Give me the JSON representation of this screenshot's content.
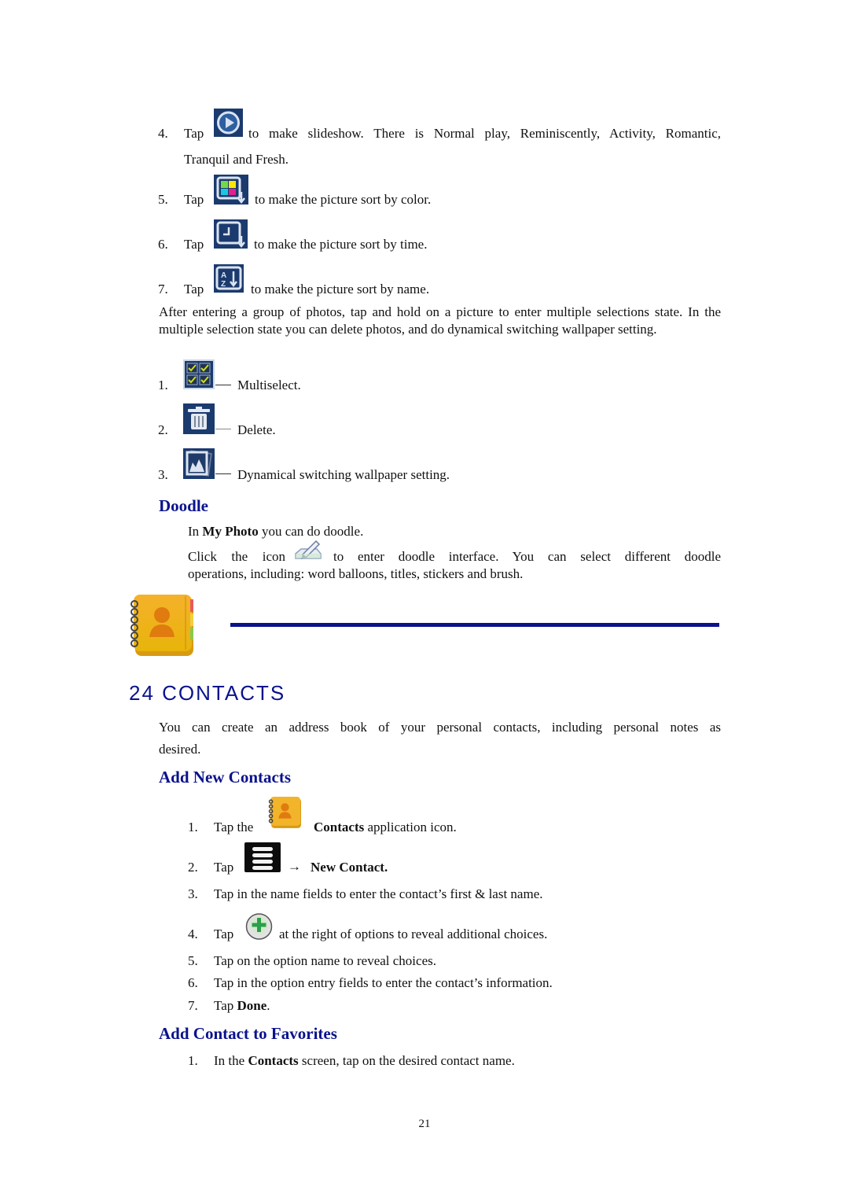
{
  "page_number": "21",
  "slideshow_steps": [
    {
      "num": "4.",
      "pre": "Tap",
      "icon": "play-slideshow-icon",
      "text": "to make slideshow. There is Normal play, Reminiscently, Activity, Romantic,",
      "text_cont": "Tranquil and Fresh."
    },
    {
      "num": "5.",
      "pre": "Tap",
      "icon": "sort-by-color-icon",
      "text": "to make the picture sort by color."
    },
    {
      "num": "6.",
      "pre": "Tap",
      "icon": "sort-by-time-icon",
      "text": "to make the picture sort by time."
    },
    {
      "num": "7.",
      "pre": "Tap",
      "icon": "sort-by-name-icon",
      "text": "to make the picture sort by name."
    }
  ],
  "multiselect_intro": "After entering a group of photos, tap and hold on a picture to enter multiple selections state. In the multiple selection state you can delete photos, and do dynamical switching wallpaper setting.",
  "multiselect_items": [
    {
      "num": "1.",
      "icon": "multiselect-icon",
      "label": "Multiselect."
    },
    {
      "num": "2.",
      "icon": "delete-icon",
      "label": "Delete."
    },
    {
      "num": "3.",
      "icon": "wallpaper-icon",
      "label": "Dynamical switching wallpaper setting."
    }
  ],
  "doodle": {
    "heading": "Doodle",
    "line1_pre": "In ",
    "line1_bold": "My Photo",
    "line1_post": " you can do doodle.",
    "line2_pre": "Click the icon",
    "line2_post": "to enter doodle interface. You can select different doodle",
    "line3": "operations, including: word balloons, titles, stickers and brush."
  },
  "chapter": {
    "title": "24 CONTACTS",
    "intro_line1": "You can create an address book of your personal contacts, including personal notes as",
    "intro_line2": "desired."
  },
  "add_new_contacts": {
    "heading": "Add New Contacts",
    "steps": [
      {
        "num": "1.",
        "pre": "Tap the",
        "bold": "Contacts",
        "post": " application icon."
      },
      {
        "num": "2.",
        "pre": "Tap",
        "arrow": "→",
        "bold": "New Contact."
      },
      {
        "num": "3.",
        "text": "Tap in the name fields to enter the contact’s first & last name."
      },
      {
        "num": "4.",
        "pre": "Tap",
        "post": "at the right of options to reveal additional choices."
      },
      {
        "num": "5.",
        "text": "Tap on the option name to reveal choices."
      },
      {
        "num": "6.",
        "text": "Tap in the option entry fields to enter the contact’s information."
      },
      {
        "num": "7.",
        "pre": "Tap ",
        "bold": "Done",
        "post": "."
      }
    ]
  },
  "add_to_favorites": {
    "heading": "Add Contact to Favorites",
    "steps": [
      {
        "num": "1.",
        "pre": "In the ",
        "bold": "Contacts",
        "post": " screen, tap on the desired contact name."
      }
    ]
  },
  "colors": {
    "heading_blue": "#0a128c",
    "icon_navy": "#1b3a6e"
  }
}
